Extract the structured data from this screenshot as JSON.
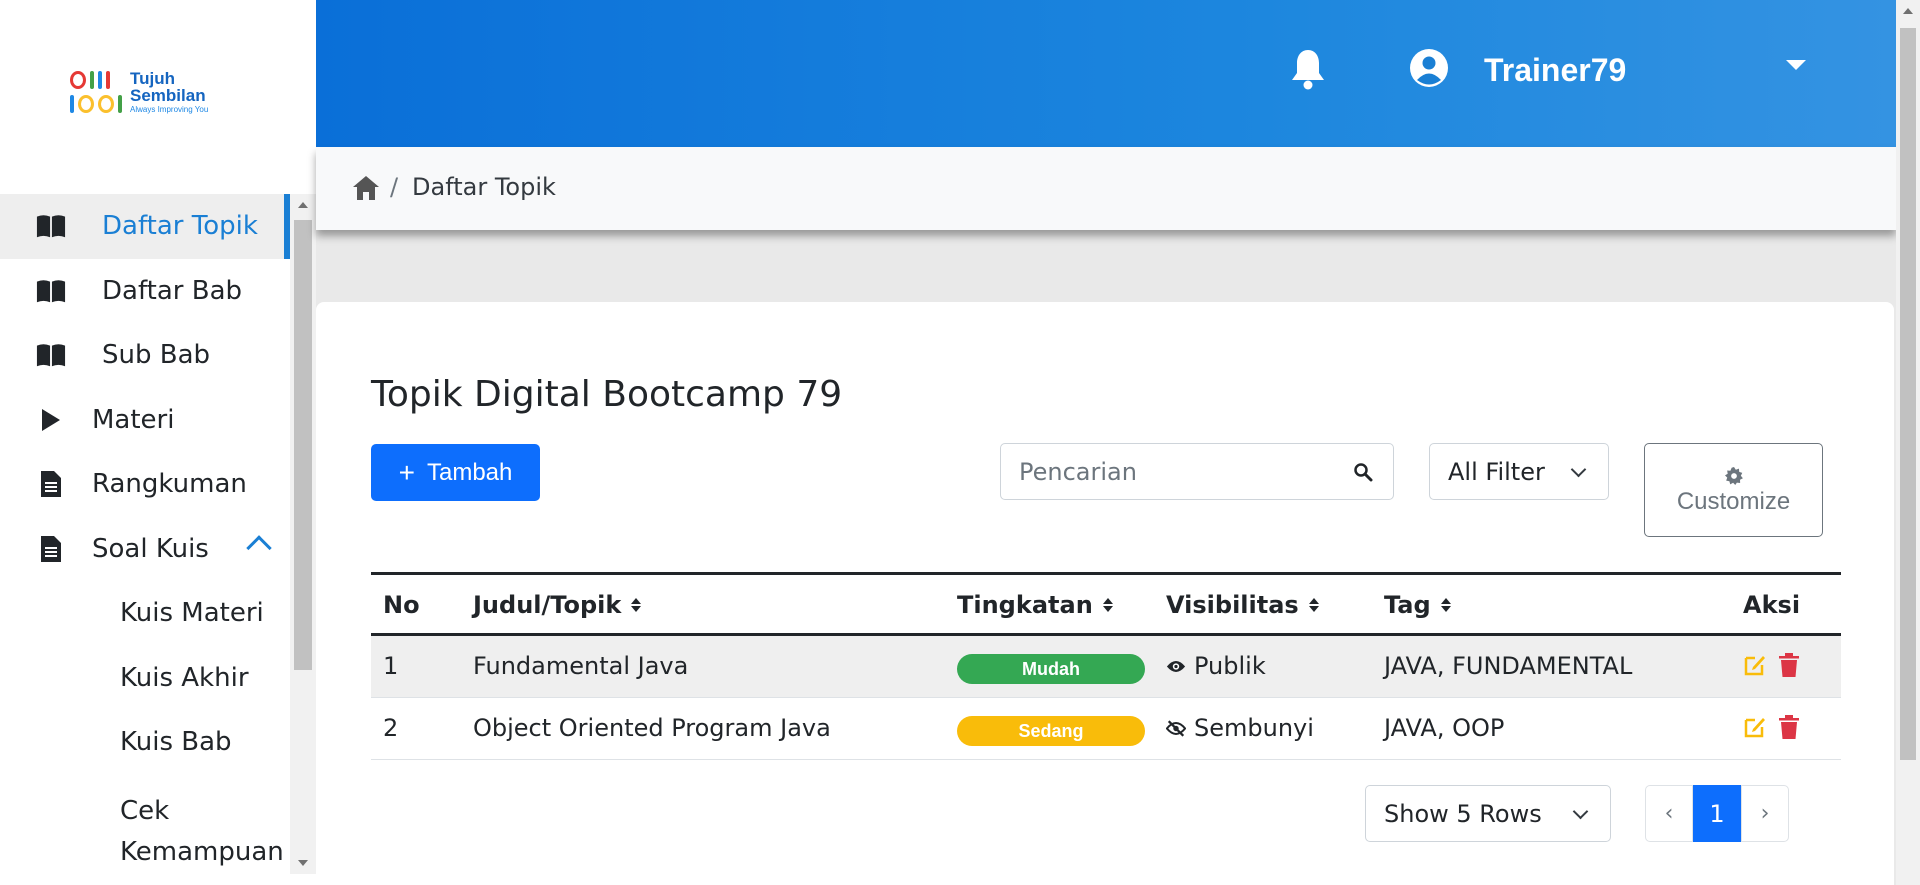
{
  "logo": {
    "line1": "Tujuh",
    "line2": "Sembilan",
    "tagline": "Always Improving You"
  },
  "sidebar": {
    "items": [
      {
        "label": "Daftar Topik",
        "icon": "book-open-icon",
        "active": true
      },
      {
        "label": "Daftar Bab",
        "icon": "book-open-icon"
      },
      {
        "label": "Sub Bab",
        "icon": "book-open-icon"
      },
      {
        "label": "Materi",
        "icon": "play-icon"
      },
      {
        "label": "Rangkuman",
        "icon": "file-text-icon"
      },
      {
        "label": "Soal Kuis",
        "icon": "file-text-icon",
        "expanded": true
      }
    ],
    "sub_items": [
      {
        "label": "Kuis Materi"
      },
      {
        "label": "Kuis Akhir"
      },
      {
        "label": "Kuis Bab"
      },
      {
        "label": "Cek Kemampuan"
      }
    ]
  },
  "header": {
    "username": "Trainer79",
    "notification_icon": "bell-icon",
    "user_icon": "user-circle-icon"
  },
  "breadcrumb": {
    "separator": "/",
    "current": "Daftar Topik"
  },
  "main": {
    "title": "Topik Digital Bootcamp 79",
    "add_button": {
      "plus": "+",
      "label": "Tambah"
    },
    "search": {
      "placeholder": "Pencarian",
      "value": ""
    },
    "filter": {
      "selected": "All Filter"
    },
    "customize": {
      "label": "Customize"
    },
    "table": {
      "headers": {
        "no": "No",
        "judul": "Judul/Topik",
        "tingkatan": "Tingkatan",
        "visibilitas": "Visibilitas",
        "tag": "Tag",
        "aksi": "Aksi"
      },
      "rows": [
        {
          "no": "1",
          "judul": "Fundamental Java",
          "tingkatan": "Mudah",
          "tingkatan_color": "#34a853",
          "visibilitas": "Publik",
          "visibility_icon": "eye-icon",
          "tag": "JAVA, FUNDAMENTAL"
        },
        {
          "no": "2",
          "judul": "Object Oriented Program Java",
          "tingkatan": "Sedang",
          "tingkatan_color": "#f9bc0a",
          "visibilitas": "Sembunyi",
          "visibility_icon": "eye-slash-icon",
          "tag": "JAVA, OOP"
        }
      ]
    },
    "rows_per_page": {
      "selected": "Show 5 Rows"
    },
    "pagination": {
      "prev": "‹",
      "current": "1",
      "next": "›"
    }
  },
  "colors": {
    "primary": "#0d6efd",
    "header_blue": "#1a7fd4",
    "edit": "#f9bc0a",
    "delete": "#dc3545"
  }
}
